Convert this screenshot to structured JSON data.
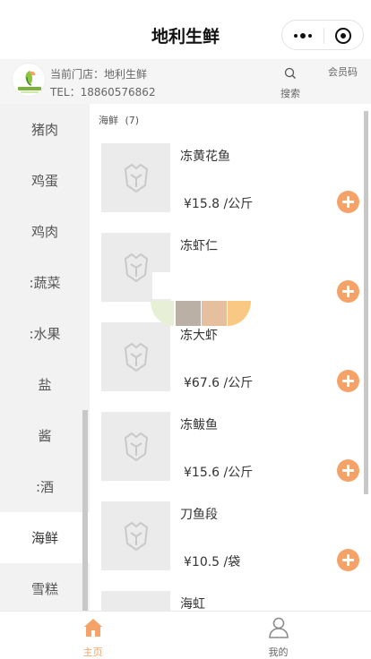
{
  "nav": {
    "title": "地利生鲜"
  },
  "store": {
    "name_line": "当前门店：地利生鲜",
    "tel_line": "TEL：18860576862",
    "logo_text": "地利生鲜",
    "search_label": "搜索",
    "member_code_label": "会员码"
  },
  "sidebar": {
    "items": [
      {
        "label": "猪肉"
      },
      {
        "label": "鸡蛋"
      },
      {
        "label": "鸡肉"
      },
      {
        "label": ":蔬菜"
      },
      {
        "label": ":水果"
      },
      {
        "label": "盐"
      },
      {
        "label": "酱"
      },
      {
        "label": ":酒"
      },
      {
        "label": "海鲜"
      },
      {
        "label": "雪糕"
      }
    ],
    "active": "海鲜"
  },
  "section": {
    "title": "海鲜",
    "count": "(7)"
  },
  "products": [
    {
      "name": "冻黄花鱼",
      "price": "¥15.8 /公斤"
    },
    {
      "name": "冻虾仁",
      "price": ""
    },
    {
      "name": "冻大虾",
      "price": "¥67.6 /公斤"
    },
    {
      "name": "冻鲅鱼",
      "price": "¥15.6 /公斤"
    },
    {
      "name": "刀鱼段",
      "price": "¥10.5 /袋"
    },
    {
      "name": "海虹",
      "price": ""
    }
  ],
  "tabbar": {
    "home_label": "主页",
    "mine_label": "我的"
  },
  "colors": {
    "accent": "#f4a267"
  }
}
